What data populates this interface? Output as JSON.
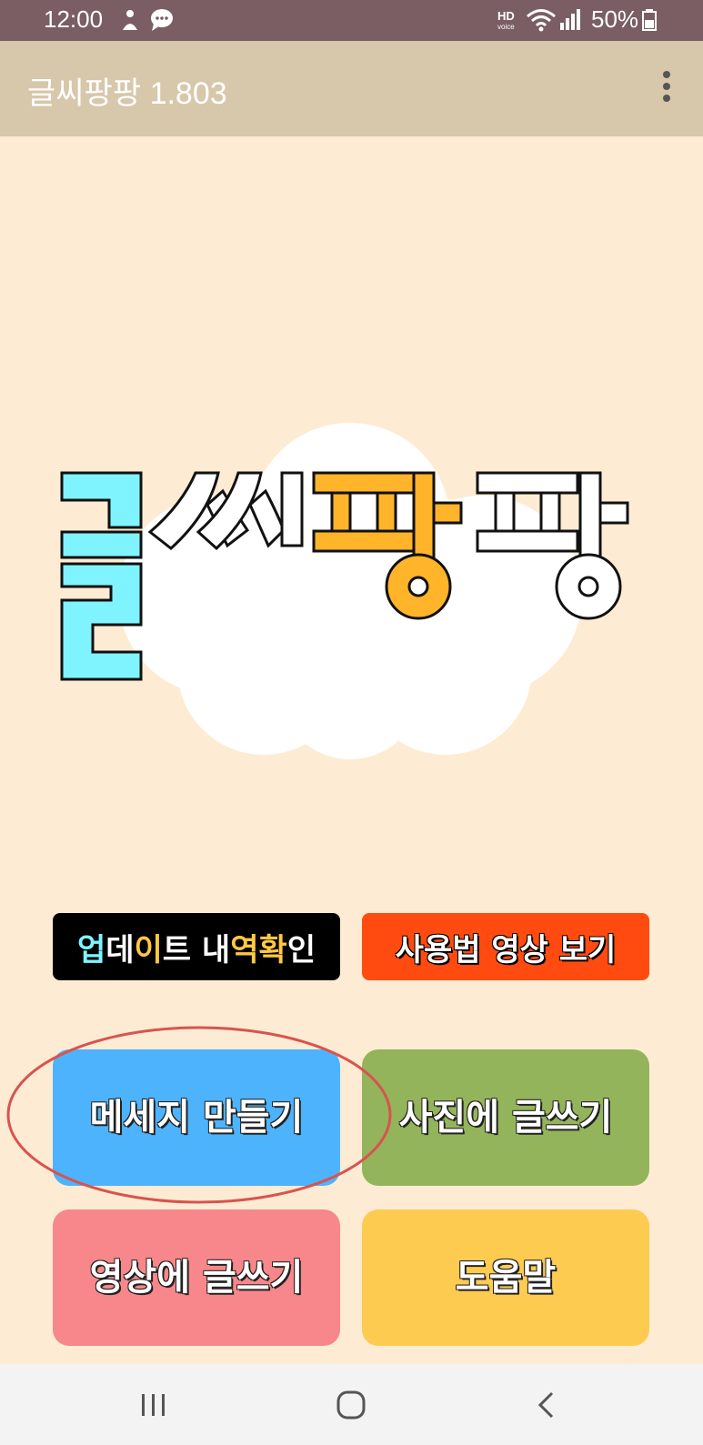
{
  "status_bar": {
    "time": "12:00",
    "battery": "50%",
    "icons": [
      "notification-person-icon",
      "chat-bubble-icon",
      "hd-voice-icon",
      "wifi-icon",
      "signal-icon",
      "battery-icon"
    ]
  },
  "app_bar": {
    "title": "글씨팡팡 1.803",
    "menu_icon": "more-vert-icon"
  },
  "logo": {
    "text": "글씨팡팡",
    "colors": {
      "cyan": "#7ff4ff",
      "orange": "#ffb42a",
      "white": "#ffffff"
    }
  },
  "buttons": {
    "update": {
      "parts": [
        "업",
        "데",
        "이",
        "트 내",
        "역 ",
        "확",
        "인"
      ]
    },
    "video": "사용법 영상 보기",
    "message": "메세지 만들기",
    "photo": "사진에 글쓰기",
    "movie": "영상에 글쓰기",
    "help": "도움말"
  },
  "colors": {
    "status_bar": "#7a5e64",
    "app_bar": "#d7c7ab",
    "background": "#fdecd3",
    "message_btn": "#4db3fc",
    "photo_btn": "#94b45b",
    "movie_btn": "#f7878a",
    "help_btn": "#fccb50",
    "video_btn": "#ff4b0f",
    "highlight_ellipse": "#d9534f"
  },
  "nav_bar": {
    "icons": [
      "recent-apps-icon",
      "home-icon",
      "back-icon"
    ]
  }
}
